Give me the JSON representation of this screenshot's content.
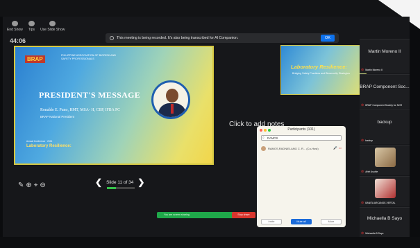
{
  "toolbar": {
    "end_show": "End Show",
    "tips": "Tips",
    "use_slide_show": "Use Slide Show"
  },
  "clock": "44:06",
  "recording_banner": {
    "text": "This meeting is being recorded. It's also being transcribed for AI Companion.",
    "ok": "OK"
  },
  "slide": {
    "logo_text": "BRAP",
    "org": "PHILIPPINE ASSOCIATION OF BIORISK AND SAFETY PROFESSIONALS",
    "heading": "PRESIDENT'S MESSAGE",
    "person": "Ronaldo E. Puno, RMT, MSA- H, CBP, IFBA PC",
    "role": "BRAP National President",
    "subtitle": "Laboratory Resilience:",
    "note": "Annual Conference · 2024"
  },
  "slide_nav": {
    "label": "Slide 11 of 34",
    "progress": 0.32
  },
  "next_slide": {
    "title": "Laboratory Resilience:",
    "text": "Bridging Safety Practices and Biosecurity Strategies"
  },
  "notes_placeholder": "Click to add notes",
  "participants": {
    "title": "Participants (101)",
    "search_value": "RAMOS",
    "row_name": "RAMOS,RADNIELANG C. R... (Co-Host)",
    "buttons": [
      "Invite",
      "Mute all",
      "More"
    ]
  },
  "share_bar": {
    "text": "You are screen sharing",
    "stop": "Stop share"
  },
  "gallery": [
    {
      "big": "Martin Moreno II",
      "small": "Martin Moreno II"
    },
    {
      "big": "BRAP Component Soc...",
      "small": "BRAP Component Society for NCR"
    },
    {
      "big": "backup",
      "small": "backup"
    },
    {
      "big": "",
      "small": "Arlet Asuhie"
    },
    {
      "big": "",
      "small": "BANITA ARCANGE-VERTAL"
    },
    {
      "big": "Michaella B Sayo",
      "small": "Michaella B Sayo"
    }
  ],
  "colors": {
    "zoom_blue": "#0e72ed",
    "share_green": "#1fa84a",
    "stop_red": "#d8352d",
    "progress_green": "#35c24a"
  }
}
